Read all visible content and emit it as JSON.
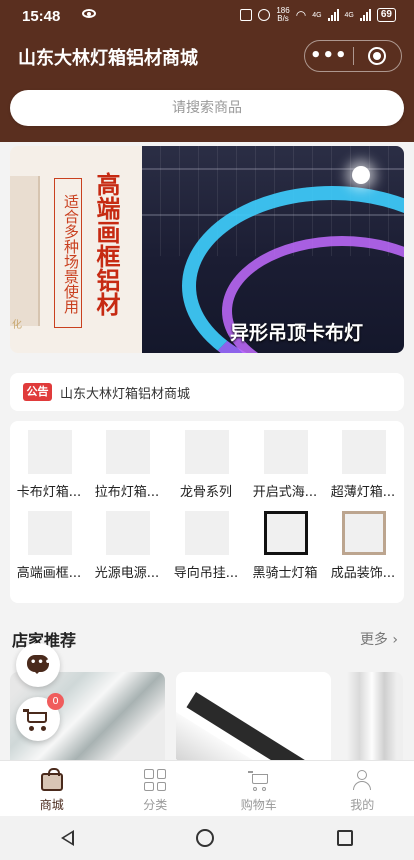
{
  "status_bar": {
    "time": "15:48",
    "network_speed": "186\nB/s",
    "signal_1": "4G",
    "signal_2": "4G",
    "battery": "69"
  },
  "header": {
    "title": "山东大林灯箱铝材商城"
  },
  "search": {
    "placeholder": "请搜索商品"
  },
  "banner": {
    "left_vertical_small": "适合多种场景使用",
    "left_vertical_big": "高端画框铝材",
    "left_corner_tag": "化",
    "right_caption": "异形吊顶卡布灯"
  },
  "notice": {
    "badge": "公告",
    "text": "山东大林灯箱铝材商城"
  },
  "categories": [
    {
      "label": "卡布灯箱..."
    },
    {
      "label": "拉布灯箱..."
    },
    {
      "label": "龙骨系列"
    },
    {
      "label": "开启式海..."
    },
    {
      "label": "超薄灯箱..."
    },
    {
      "label": "高端画框..."
    },
    {
      "label": "光源电源..."
    },
    {
      "label": "导向吊挂..."
    },
    {
      "label": "黑骑士灯箱"
    },
    {
      "label": "成品装饰..."
    }
  ],
  "recommend": {
    "title": "店家推荐",
    "more": "更多"
  },
  "cart": {
    "count": "0"
  },
  "tabbar": {
    "items": [
      {
        "label": "商城"
      },
      {
        "label": "分类"
      },
      {
        "label": "购物车"
      },
      {
        "label": "我的"
      }
    ]
  },
  "colors": {
    "brand": "#5a2f1f",
    "badge_red": "#e03b3b",
    "active_tab": "#4a2a1c"
  }
}
